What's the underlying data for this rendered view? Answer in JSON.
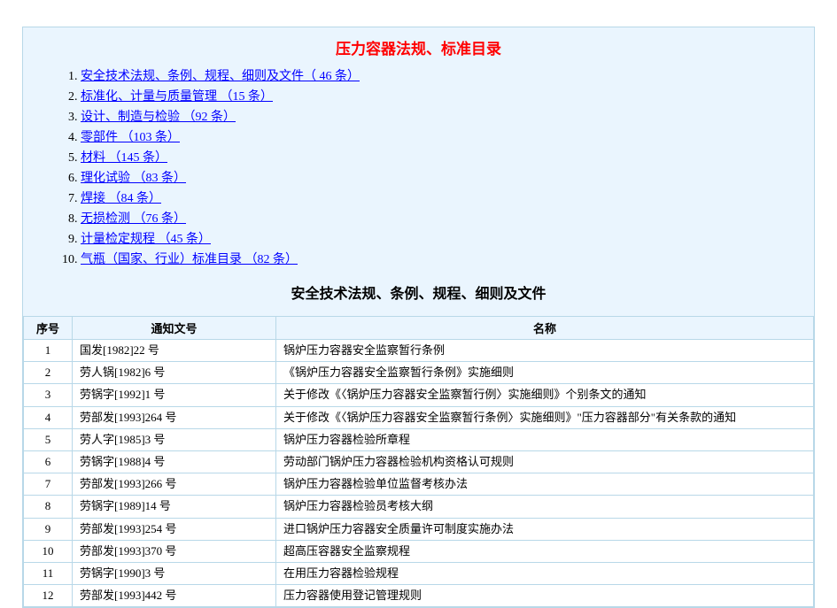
{
  "title": "压力容器法规、标准目录",
  "toc": [
    "安全技术法规、条例、规程、细则及文件（ 46 条）",
    "标准化、计量与质量管理 （15 条）",
    "设计、制造与检验 （92 条）",
    "零部件 （103 条）",
    "材料 （145 条）",
    "理化试验 （83 条）",
    "焊接 （84 条）",
    "无损检测 （76 条）",
    "计量检定规程 （45 条）",
    "气瓶（国家、行业）标准目录  （82 条）"
  ],
  "subtitle": "安全技术法规、条例、规程、细则及文件",
  "table": {
    "headers": {
      "seq": "序号",
      "doc": "通知文号",
      "name": "名称"
    },
    "rows": [
      {
        "seq": "1",
        "doc": "国发[1982]22 号",
        "name": "锅炉压力容器安全监察暂行条例"
      },
      {
        "seq": "2",
        "doc": "劳人锅[1982]6 号",
        "name": "《锅炉压力容器安全监察暂行条例》实施细则"
      },
      {
        "seq": "3",
        "doc": "劳锅字[1992]1 号",
        "name": "关于修改《〈锅炉压力容器安全监察暂行例〉实施细则》个别条文的通知"
      },
      {
        "seq": "4",
        "doc": "劳部发[1993]264 号",
        "name": "关于修改《〈锅炉压力容器安全监察暂行条例〉实施细则》\"压力容器部分\"有关条款的通知"
      },
      {
        "seq": "5",
        "doc": "劳人字[1985]3 号",
        "name": "锅炉压力容器检验所章程"
      },
      {
        "seq": "6",
        "doc": "劳锅字[1988]4 号",
        "name": "劳动部门锅炉压力容器检验机构资格认可规则"
      },
      {
        "seq": "7",
        "doc": "劳部发[1993]266 号",
        "name": "锅炉压力容器检验单位监督考核办法"
      },
      {
        "seq": "8",
        "doc": "劳锅字[1989]14 号",
        "name": "锅炉压力容器检验员考核大纲"
      },
      {
        "seq": "9",
        "doc": "劳部发[1993]254 号",
        "name": "进口锅炉压力容器安全质量许可制度实施办法"
      },
      {
        "seq": "10",
        "doc": "劳部发[1993]370 号",
        "name": "超高压容器安全监察规程"
      },
      {
        "seq": "11",
        "doc": "劳锅字[1990]3 号",
        "name": "在用压力容器检验规程"
      },
      {
        "seq": "12",
        "doc": "劳部发[1993]442 号",
        "name": "压力容器使用登记管理规则"
      }
    ]
  }
}
